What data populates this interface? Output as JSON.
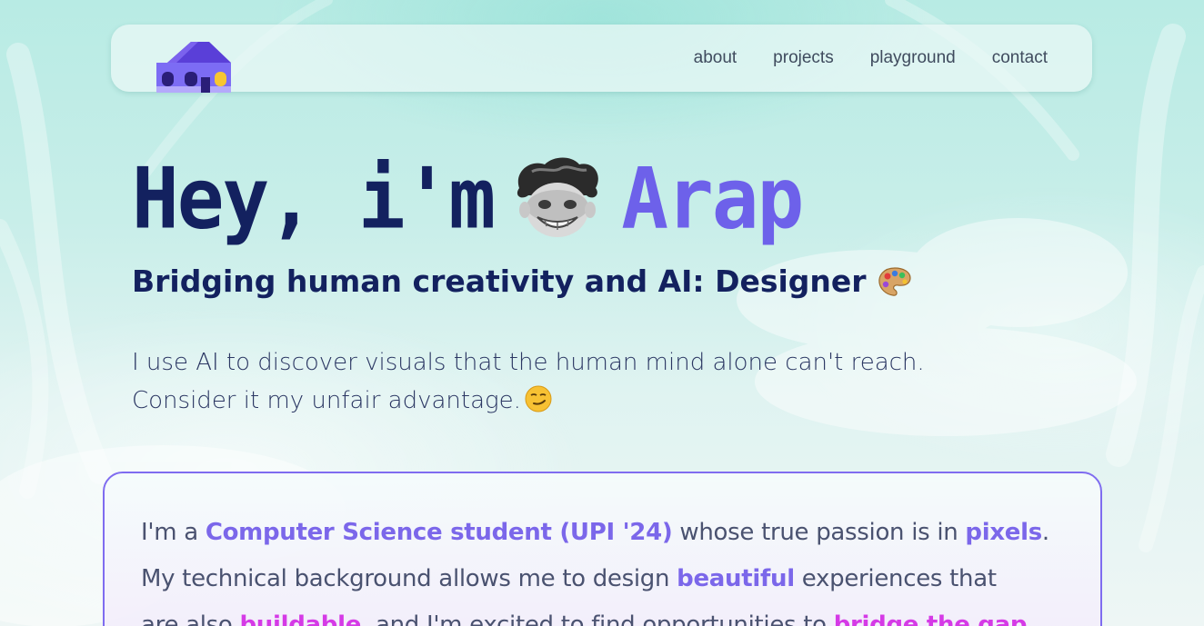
{
  "nav": {
    "links": [
      "about",
      "projects",
      "playground",
      "contact"
    ]
  },
  "hero": {
    "greeting": "Hey, i'm",
    "name": "Arap",
    "subtitle": "Bridging human creativity and AI: Designer",
    "intro_line1": "I use AI to discover visuals that the human mind alone can't reach.",
    "intro_line2": "Consider it my unfair advantage."
  },
  "bio": {
    "l1_a": "I'm a ",
    "l1_b": "Computer Science student (UPI '24)",
    "l1_c": " whose true passion is in ",
    "l1_d": "pixels",
    "l1_e": ".",
    "l2_a": "My technical background allows me to design ",
    "l2_b": "beautiful",
    "l2_c": " experiences that",
    "l3_a": "are also ",
    "l3_b": "buildable",
    "l3_c": ", and I'm excited to find opportunities to ",
    "l3_d": "bridge the gap"
  },
  "icons": {
    "logo": "house-logo-icon",
    "avatar": "avatar-face-icon",
    "subtitle_emoji": "artist-palette-icon",
    "intro_emoji": "smirking-face-icon"
  },
  "colors": {
    "navy": "#13215f",
    "accent_purple": "#6d61ea",
    "highlight_purple": "#7b67ea",
    "highlight_magenta": "#d53ae6",
    "card_border": "#7f6cf0"
  }
}
